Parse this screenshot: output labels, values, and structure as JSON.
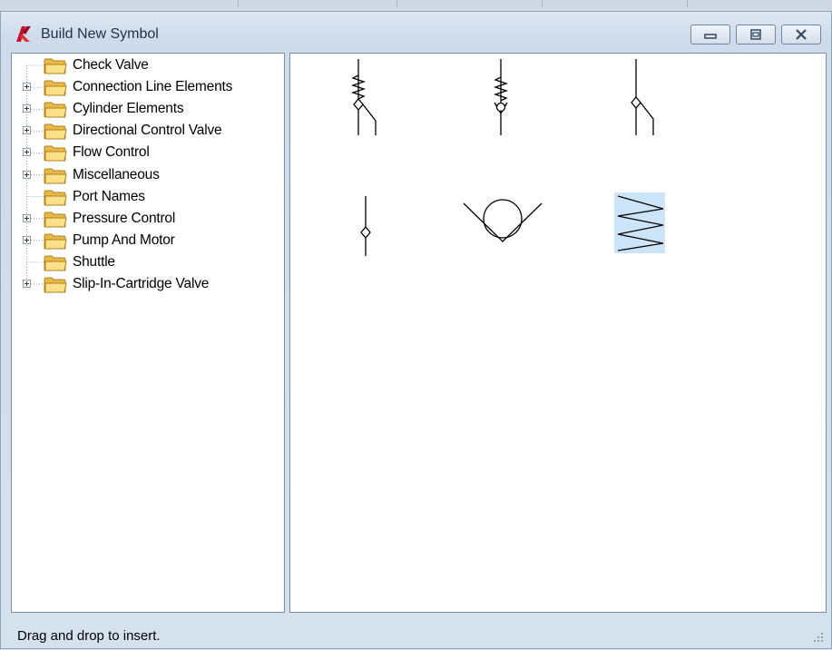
{
  "window": {
    "title": "Build New Symbol",
    "icons": {
      "app": "autodesk-logo-icon",
      "minimize": "minimize-icon",
      "maximize": "maximize-icon",
      "close": "close-icon"
    }
  },
  "tree": {
    "items": [
      {
        "label": "Check Valve",
        "expandable": false,
        "icon": "folder-icon"
      },
      {
        "label": "Connection Line Elements",
        "expandable": true,
        "icon": "folder-icon"
      },
      {
        "label": "Cylinder Elements",
        "expandable": true,
        "icon": "folder-icon"
      },
      {
        "label": "Directional Control Valve",
        "expandable": true,
        "icon": "folder-icon"
      },
      {
        "label": "Flow Control",
        "expandable": true,
        "icon": "folder-icon"
      },
      {
        "label": "Miscellaneous",
        "expandable": true,
        "icon": "folder-icon"
      },
      {
        "label": "Port Names",
        "expandable": false,
        "icon": "folder-icon"
      },
      {
        "label": "Pressure Control",
        "expandable": true,
        "icon": "folder-icon"
      },
      {
        "label": "Pump And Motor",
        "expandable": true,
        "icon": "folder-icon"
      },
      {
        "label": "Shuttle",
        "expandable": false,
        "icon": "folder-icon"
      },
      {
        "label": "Slip-In-Cartridge Valve",
        "expandable": true,
        "icon": "folder-icon"
      }
    ]
  },
  "symbols": [
    {
      "icon": "spring-check-valve-with-line-icon",
      "selected": false
    },
    {
      "icon": "spring-check-valve-icon",
      "selected": false
    },
    {
      "icon": "check-valve-with-line-icon",
      "selected": false
    },
    {
      "icon": "small-check-valve-icon",
      "selected": false
    },
    {
      "icon": "check-valve-seat-icon",
      "selected": false
    },
    {
      "icon": "spring-icon",
      "selected": true
    }
  ],
  "colors": {
    "selection": "#cce4f7",
    "accent": "#c8102e"
  },
  "status": {
    "text": "Drag and drop to insert."
  }
}
